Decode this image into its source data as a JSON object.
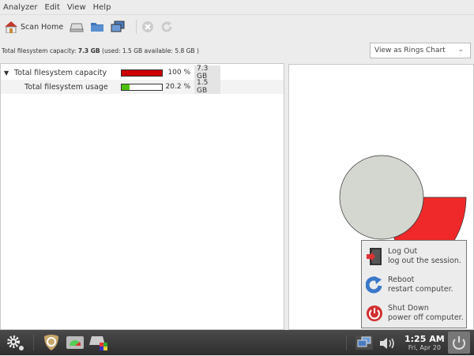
{
  "menu": [
    "Analyzer",
    "Edit",
    "View",
    "Help"
  ],
  "toolbar": {
    "scan_home": "Scan Home"
  },
  "info": {
    "prefix": "Total filesystem capacity: ",
    "capacity": "7.3 GB",
    "rest": " (used: 1.5 GB available: 5.8 GB )"
  },
  "view_combo": {
    "selected": "View as Rings Chart"
  },
  "tree": [
    {
      "name": "Total filesystem capacity",
      "percent": "100 %",
      "fill": 100,
      "size": "7.3 GB",
      "color": "#cc0000"
    },
    {
      "name": "Total filesystem usage",
      "percent": "20.2 %",
      "fill": 20.2,
      "size": "1.5 GB",
      "color": "#4ec00c"
    }
  ],
  "chart_data": {
    "type": "pie",
    "variant": "rings",
    "center_color": "#d3d7cf",
    "segments": [
      {
        "value": 20.2,
        "color": "#ef2929"
      }
    ]
  },
  "session_menu": [
    {
      "title": "Log Out",
      "desc": "log out the session."
    },
    {
      "title": "Reboot",
      "desc": "restart computer."
    },
    {
      "title": "Shut Down",
      "desc": "power off computer."
    }
  ],
  "clock": {
    "time": "1:25 AM",
    "date": "Fri, Apr 20"
  }
}
